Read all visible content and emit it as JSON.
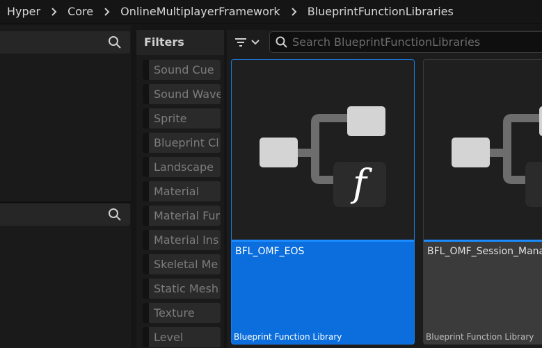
{
  "breadcrumb": [
    "Hyper",
    "Core",
    "OnlineMultiplayerFramework",
    "BlueprintFunctionLibraries"
  ],
  "filters": {
    "title": "Filters",
    "items": [
      "Sound Cue",
      "Sound Wave",
      "Sprite",
      "Blueprint Cl",
      "Landscape",
      "Material",
      "Material Fur",
      "Material Ins",
      "Skeletal Me",
      "Static Mesh",
      "Texture",
      "Level"
    ]
  },
  "search": {
    "placeholder": "Search BlueprintFunctionLibraries",
    "value": ""
  },
  "assets": [
    {
      "name": "BFL_OMF_EOS",
      "type": "Blueprint Function Library",
      "selected": true
    },
    {
      "name": "BFL_OMF_Session_Mana",
      "type": "Blueprint Function Library",
      "selected": false
    }
  ],
  "icons": {
    "breadcrumb_separator": "chevron-right-icon",
    "search": "search-icon",
    "view_options": "filter-lines-icon",
    "dropdown": "chevron-down-icon",
    "thumbnail": "blueprint-function-icon"
  },
  "colors": {
    "selection": "#0B6EDC",
    "accent": "#1A8CFF",
    "background": "#151515"
  }
}
